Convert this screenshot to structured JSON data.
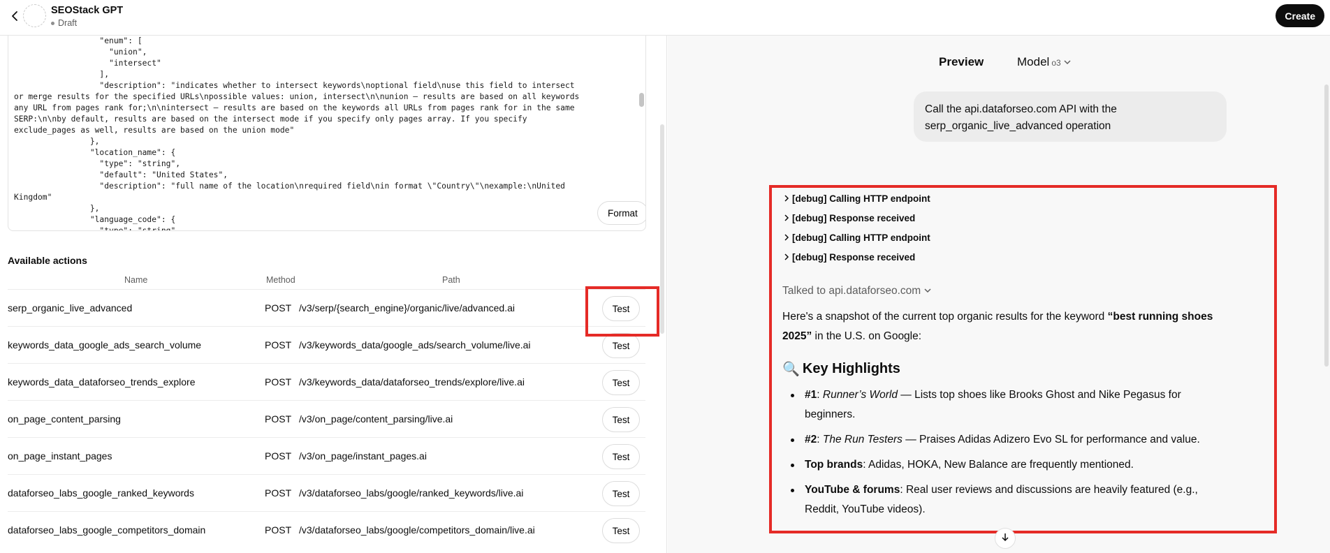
{
  "header": {
    "app_name": "SEOStack GPT",
    "status": "Draft",
    "create_label": "Create"
  },
  "schema": {
    "lines": [
      "                  \"enum\": [",
      "                    \"union\",",
      "                    \"intersect\"",
      "                  ],",
      "                  \"description\": \"indicates whether to intersect keywords\\noptional field\\nuse this field to intersect",
      "or merge results for the specified URLs\\npossible values: union, intersect\\n\\nunion – results are based on all keywords",
      "any URL from pages rank for;\\n\\nintersect – results are based on the keywords all URLs from pages rank for in the same",
      "SERP:\\n\\nby default, results are based on the intersect mode if you specify only pages array. If you specify",
      "exclude_pages as well, results are based on the union mode\"",
      "                },",
      "                \"location_name\": {",
      "                  \"type\": \"string\",",
      "                  \"default\": \"United States\",",
      "                  \"description\": \"full name of the location\\nrequired field\\nin format \\\"Country\\\"\\nexample:\\nUnited",
      "Kingdom\"",
      "                },",
      "                \"language_code\": {",
      "                  \"type\": \"string\","
    ],
    "format_label": "Format"
  },
  "actions": {
    "title": "Available actions",
    "col_name": "Name",
    "col_method": "Method",
    "col_path": "Path",
    "test_label": "Test",
    "rows": [
      {
        "name": "serp_organic_live_advanced",
        "method": "POST",
        "path": "/v3/serp/{search_engine}/organic/live/advanced.ai"
      },
      {
        "name": "keywords_data_google_ads_search_volume",
        "method": "POST",
        "path": "/v3/keywords_data/google_ads/search_volume/live.ai"
      },
      {
        "name": "keywords_data_dataforseo_trends_explore",
        "method": "POST",
        "path": "/v3/keywords_data/dataforseo_trends/explore/live.ai"
      },
      {
        "name": "on_page_content_parsing",
        "method": "POST",
        "path": "/v3/on_page/content_parsing/live.ai"
      },
      {
        "name": "on_page_instant_pages",
        "method": "POST",
        "path": "/v3/on_page/instant_pages.ai"
      },
      {
        "name": "dataforseo_labs_google_ranked_keywords",
        "method": "POST",
        "path": "/v3/dataforseo_labs/google/ranked_keywords/live.ai"
      },
      {
        "name": "dataforseo_labs_google_competitors_domain",
        "method": "POST",
        "path": "/v3/dataforseo_labs/google/competitors_domain/live.ai"
      }
    ]
  },
  "preview": {
    "title": "Preview",
    "model_label": "Model",
    "model_value": "o3",
    "user_message": "Call the api.dataforseo.com API with the serp_organic_live_advanced operation",
    "debug": [
      "[debug] Calling HTTP endpoint",
      "[debug] Response received",
      "[debug] Calling HTTP endpoint",
      "[debug] Response received"
    ],
    "talked_to": "Talked to api.dataforseo.com",
    "intro_prefix": "Here's a snapshot of the current top organic results for the keyword ",
    "intro_keyword": "“best running shoes 2025”",
    "intro_suffix": " in the U.S. on Google:",
    "highlights_icon": "🔍",
    "highlights_title": "Key Highlights",
    "bullets": [
      {
        "bold": "#1",
        "sep": ": ",
        "italic": "Runner’s World",
        "text": " — Lists top shoes like Brooks Ghost and Nike Pegasus for beginners."
      },
      {
        "bold": "#2",
        "sep": ": ",
        "italic": "The Run Testers",
        "text": " — Praises Adidas Adizero Evo SL for performance and value."
      },
      {
        "bold": "Top brands",
        "sep": ": ",
        "italic": "",
        "text": "Adidas, HOKA, New Balance are frequently mentioned."
      },
      {
        "bold": "YouTube & forums",
        "sep": ": ",
        "italic": "",
        "text": "Real user reviews and discussions are heavily featured (e.g., Reddit, YouTube videos)."
      }
    ]
  },
  "colors": {
    "highlight_border": "#e52b27",
    "primary_button": "#0d0d0d"
  }
}
